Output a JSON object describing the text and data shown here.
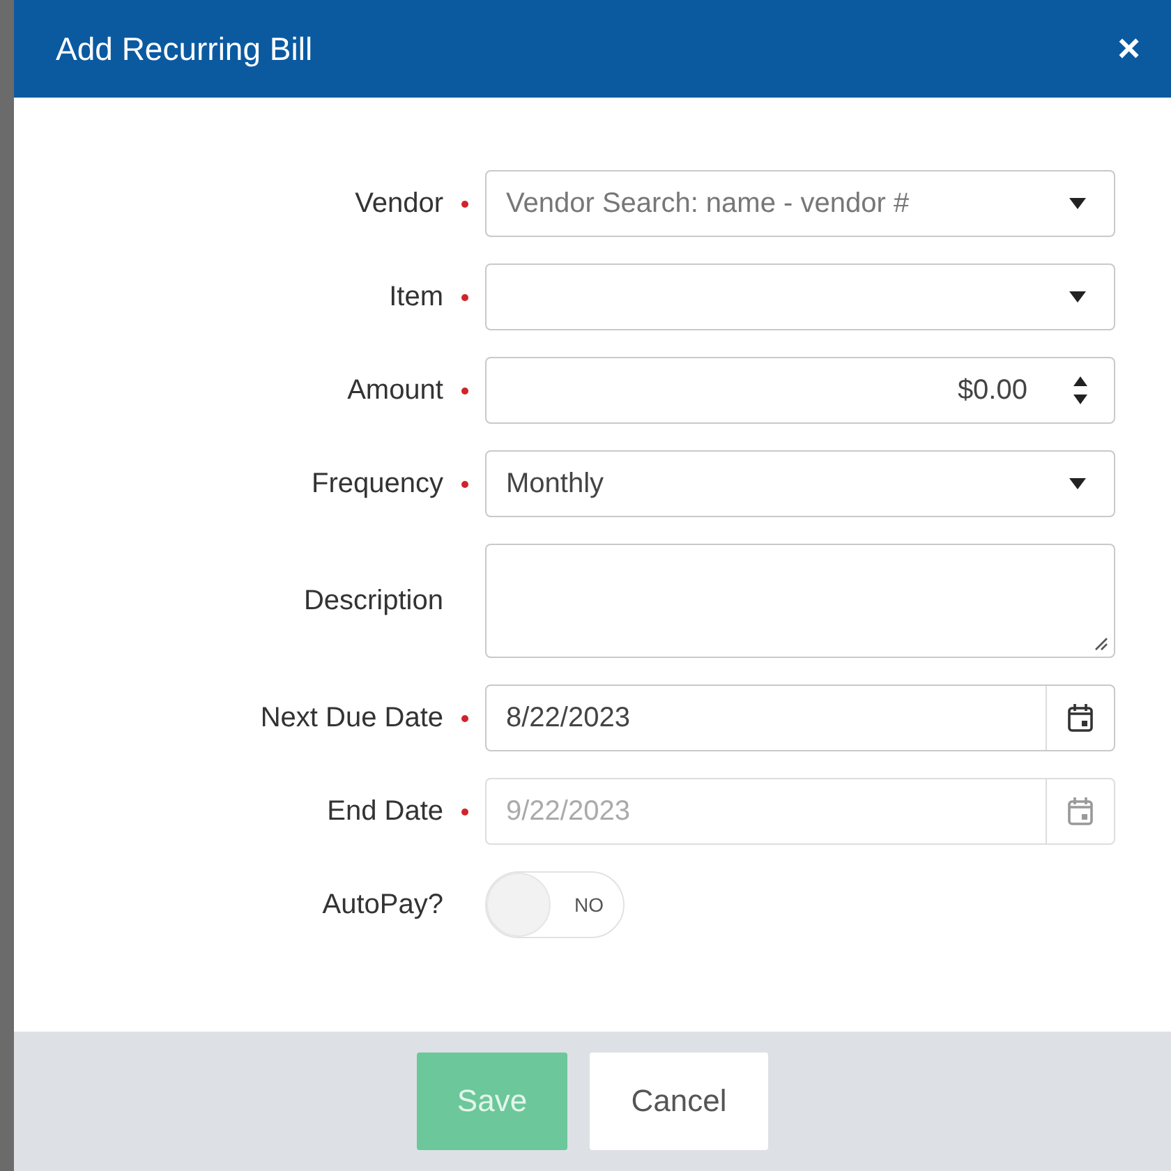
{
  "dialog": {
    "title": "Add Recurring Bill",
    "close_icon": "×"
  },
  "fields": [
    {
      "kind": "select",
      "label": "Vendor",
      "required": true,
      "placeholder": "Vendor Search: name - vendor #",
      "disabled": false
    },
    {
      "kind": "select",
      "label": "Item",
      "required": true,
      "disabled": false
    },
    {
      "kind": "number",
      "label": "Amount",
      "required": true,
      "value": "$0.00",
      "disabled": false
    },
    {
      "kind": "select",
      "label": "Frequency",
      "required": true,
      "value": "Monthly",
      "disabled": false
    },
    {
      "kind": "textarea",
      "label": "Description",
      "required": false,
      "disabled": false
    },
    {
      "kind": "date",
      "label": "Next Due Date",
      "required": true,
      "value": "8/22/2023",
      "disabled": false
    },
    {
      "kind": "date",
      "label": "End Date",
      "required": true,
      "value": "9/22/2023",
      "disabled": true
    },
    {
      "kind": "toggle",
      "label": "AutoPay?",
      "on": false,
      "state_text": "NO"
    }
  ],
  "buttons": [
    {
      "label": "Save",
      "kind": "primary",
      "disabled": true
    },
    {
      "label": "Cancel",
      "kind": "secondary",
      "disabled": false
    }
  ]
}
